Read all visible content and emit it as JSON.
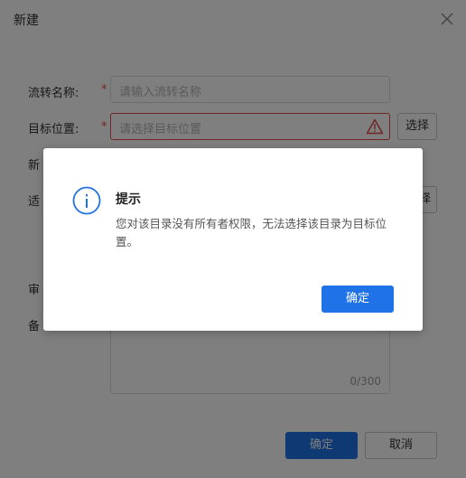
{
  "dialog": {
    "title": "新建",
    "form": {
      "name_label": "流转名称:",
      "name_placeholder": "请输入流转名称",
      "target_label": "目标位置:",
      "target_placeholder": "请选择目标位置",
      "select_button": "选择",
      "partial_label_1": "新",
      "partial_label_2": "适",
      "partial_button_fragment": "择",
      "partial_label_3": "审",
      "partial_label_4": "备",
      "remark_counter": "0/300",
      "required_marker": "*"
    },
    "footer": {
      "confirm": "确定",
      "cancel": "取消"
    }
  },
  "alert": {
    "title": "提示",
    "message": "您对该目录没有所有者权限，无法选择该目录为目标位置。",
    "ok": "确定"
  },
  "colors": {
    "primary": "#1f73e6",
    "error": "#e04a4a",
    "overlay": "rgba(0,0,0,0.5)",
    "info": "#1f73e6"
  },
  "icons": {
    "close": "close-icon",
    "warning": "warning-triangle-icon",
    "info": "info-circle-icon"
  }
}
